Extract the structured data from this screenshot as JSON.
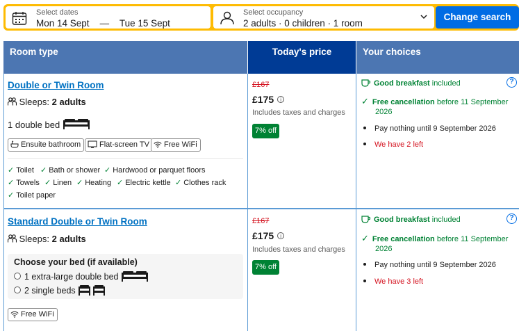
{
  "search": {
    "dates_label": "Select dates",
    "check_in": "Mon 14 Sept",
    "dash": "—",
    "check_out": "Tue 15 Sept",
    "occupancy_label": "Select occupancy",
    "occupancy_value": "2 adults · 0 children · 1 room",
    "change_button": "Change search"
  },
  "table": {
    "headers": [
      "Room type",
      "Today's price",
      "Your choices"
    ]
  },
  "rooms": [
    {
      "name": "Double or Twin Room",
      "sleeps_label": "Sleeps:",
      "sleeps_value": "2 adults",
      "bed": "1 double bed",
      "amenities": [
        "Ensuite bathroom",
        "Flat-screen TV",
        "Free WiFi"
      ],
      "facilities": [
        "Toilet",
        "Bath or shower",
        "Hardwood or parquet floors",
        "Towels",
        "Linen",
        "Heating",
        "Electric kettle",
        "Clothes rack",
        "Toilet paper"
      ],
      "old_price": "£167",
      "price": "£175",
      "taxes": "Includes taxes and charges",
      "discount": "7% off",
      "breakfast_bold": "Good breakfast",
      "breakfast_rest": "included",
      "cancel_bold": "Free cancellation",
      "cancel_rest": "before 11 September",
      "cancel_year": "2026",
      "pay": "Pay nothing until 9 September 2026",
      "left": "We have 2 left"
    },
    {
      "name": "Standard Double or Twin Room",
      "sleeps_label": "Sleeps:",
      "sleeps_value": "2 adults",
      "bed_choice_title": "Choose your bed (if available)",
      "bed_options": [
        "1 extra-large double bed",
        "2 single beds"
      ],
      "amenities": [
        "Free WiFi"
      ],
      "old_price": "£167",
      "price": "£175",
      "taxes": "Includes taxes and charges",
      "discount": "7% off",
      "breakfast_bold": "Good breakfast",
      "breakfast_rest": "included",
      "cancel_bold": "Free cancellation",
      "cancel_rest": "before 11 September",
      "cancel_year": "2026",
      "pay": "Pay nothing until 9 September 2026",
      "left": "We have 3 left"
    }
  ],
  "colors": {
    "search_border": "#febb02",
    "button_blue": "#006ce4",
    "header_blue": "#4c76b2",
    "header_dark": "#003b95",
    "link_blue": "#0071c2",
    "green": "#008234",
    "red": "#d4111e"
  },
  "icons": [
    "calendar-icon",
    "person-icon",
    "chevron-down-icon",
    "sleeps-icon",
    "double-bed-icon",
    "bathroom-icon",
    "tv-icon",
    "wifi-icon",
    "check-icon",
    "info-icon",
    "coffee-icon",
    "question-icon",
    "single-bed-icon"
  ]
}
